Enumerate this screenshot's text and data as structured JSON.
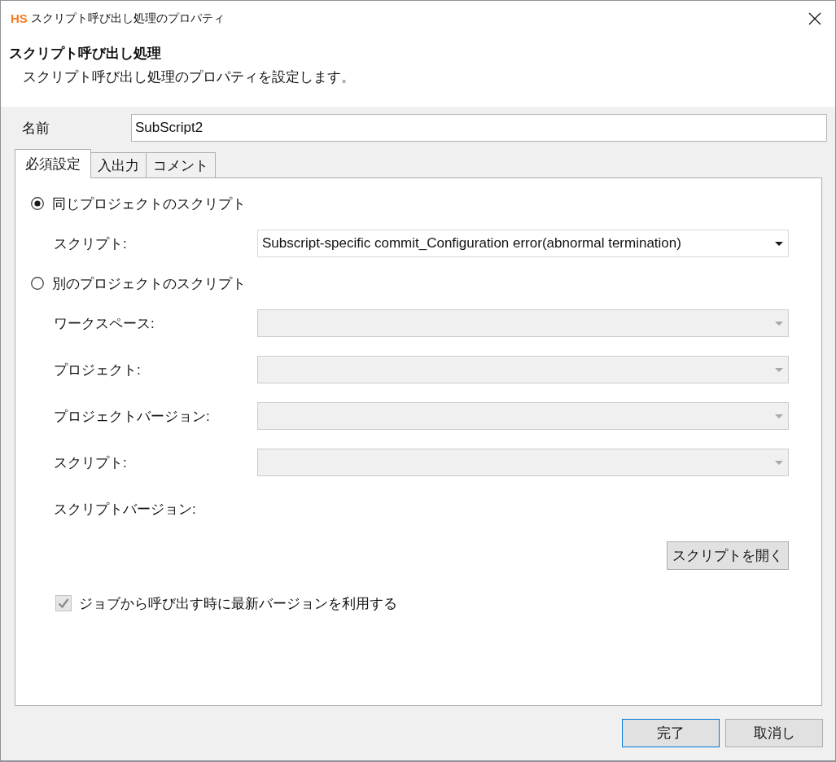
{
  "window": {
    "logo": "HS",
    "title": "スクリプト呼び出し処理のプロパティ"
  },
  "header": {
    "title": "スクリプト呼び出し処理",
    "description": "スクリプト呼び出し処理のプロパティを設定します。"
  },
  "name_field": {
    "label": "名前",
    "value": "SubScript2"
  },
  "tabs": [
    {
      "label": "必須設定",
      "selected": true
    },
    {
      "label": "入出力",
      "selected": false
    },
    {
      "label": "コメント",
      "selected": false
    }
  ],
  "script_source": [
    {
      "label": "同じプロジェクトのスクリプト",
      "selected": true,
      "fields": [
        {
          "kind": "dropdown",
          "label": "スクリプト:",
          "value": "Subscript-specific commit_Configuration error(abnormal termination)",
          "disabled": false
        }
      ]
    },
    {
      "label": "別のプロジェクトのスクリプト",
      "selected": false,
      "fields": [
        {
          "kind": "dropdown",
          "label": "ワークスペース:",
          "disabled": true
        },
        {
          "kind": "dropdown",
          "label": "プロジェクト:",
          "disabled": true
        },
        {
          "kind": "dropdown",
          "label": "プロジェクトバージョン:",
          "disabled": true
        },
        {
          "kind": "dropdown",
          "label": "スクリプト:",
          "disabled": true
        },
        {
          "kind": "readout",
          "label": "スクリプトバージョン:"
        }
      ]
    }
  ],
  "open_script_button": {
    "label": "スクリプトを開く"
  },
  "latest_version_checkbox": {
    "label": "ジョブから呼び出す時に最新バージョンを利用する",
    "checked": true,
    "disabled": true
  },
  "buttons": [
    {
      "label": "完了",
      "default": true
    },
    {
      "label": "取消し",
      "default": false
    }
  ]
}
